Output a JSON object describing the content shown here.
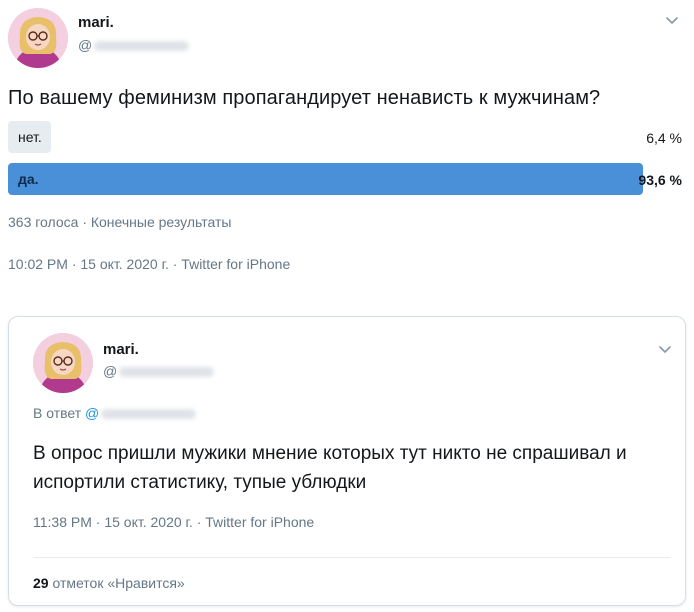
{
  "tweet": {
    "author_name": "mari.",
    "handle_prefix": "@",
    "question": "По вашему феминизм пропагандирует ненависть к мужчинам?",
    "poll": {
      "options": [
        {
          "label": "нет.",
          "percent_text": "6,4 %",
          "percent": 6.4
        },
        {
          "label": "да.",
          "percent_text": "93,6 %",
          "percent": 93.6
        }
      ],
      "votes_text": "363 голоса · Конечные результаты",
      "winner_color": "#4a90d9",
      "loser_color": "#e6ecf0"
    },
    "meta": "10:02 PM · 15 окт. 2020 г. · Twitter for iPhone"
  },
  "reply": {
    "author_name": "mari.",
    "handle_prefix": "@",
    "reply_to_label": "В ответ",
    "reply_to_prefix": "@",
    "text": "В опрос пришли мужики мнение которых тут никто не спрашивал и испортили статистику, тупые ублюдки",
    "meta": "11:38 PM · 15 окт. 2020 г. · Twitter for iPhone",
    "likes_count": "29",
    "likes_label": "отметок «Нравится»"
  },
  "icons": {
    "avatar": "avatar-illustration",
    "menu": "chevron-down-icon"
  }
}
